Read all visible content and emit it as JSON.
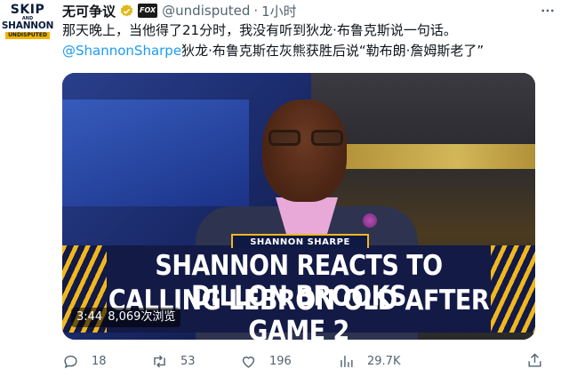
{
  "avatar": {
    "line1": "SKIP",
    "line2": "AND",
    "line3": "SHANNON",
    "badge": "UNDISPUTED"
  },
  "header": {
    "name": "无可争议",
    "verified_icon": "verified-badge-icon",
    "fox_label": "FOX",
    "handle": "@undisputed",
    "separator": "·",
    "time": "1小时",
    "more_icon": "more-icon"
  },
  "tweet": {
    "line1": "那天晚上，当他得了21分时，我没有听到狄龙·布鲁克斯说一句话。",
    "mention": "@ShannonSharpe",
    "line2_rest": "狄龙·布鲁克斯在灰熊获胜后说“勒布朗·詹姆斯老了”"
  },
  "media": {
    "nameplate": "SHANNON SHARPE",
    "headline_line1": "SHANNON REACTS TO DILLON BROOKS",
    "headline_line2": "CALLING LEBRON OLD AFTER GAME 2",
    "duration": "3:44",
    "views": "8,069次浏览"
  },
  "actions": {
    "reply_count": "18",
    "retweet_count": "53",
    "like_count": "196",
    "views_count": "29.7K"
  },
  "colors": {
    "accent": "#1d9bf0",
    "muted": "#536471",
    "brand_gold": "#f1b71f"
  }
}
